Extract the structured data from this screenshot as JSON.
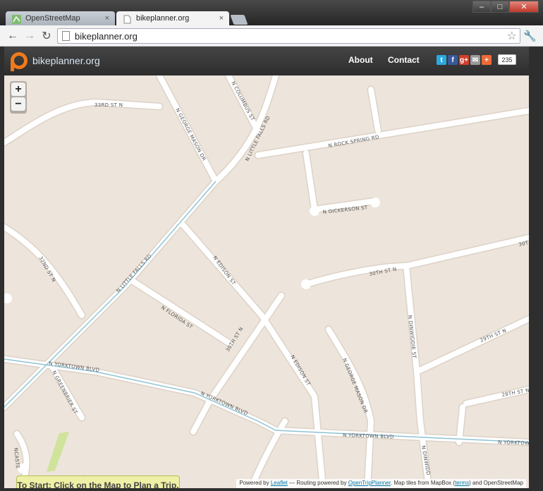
{
  "browser": {
    "tabs": [
      {
        "title": "OpenStreetMap",
        "close": "×"
      },
      {
        "title": "bikeplanner.org",
        "close": "×"
      }
    ],
    "url": "bikeplanner.org",
    "window_buttons": [
      "–",
      "□",
      "✕"
    ]
  },
  "site": {
    "brand": "bikeplanner.org",
    "nav": {
      "about": "About",
      "contact": "Contact"
    },
    "share_count": "235",
    "accent": "#f07a1a"
  },
  "map": {
    "zoom_in": "+",
    "zoom_out": "−",
    "hint": "To Start: Click on the Map to Plan a Trip.",
    "labels": {
      "st33": "33RD ST N",
      "george_mason_n": "N GEORGE MASON DR",
      "columbus": "N COLUMBUS ST",
      "little_falls_n": "N LITTLE FALLS RD",
      "rock_spring": "N ROCK SPRING RD",
      "dickerson": "N DICKERSON ST",
      "st32": "32ND ST N",
      "little_falls_s": "N LITTLE FALLS RD",
      "edison_n": "N EDISON ST",
      "st30": "30TH ST N",
      "st30_right": "30T",
      "florida": "N FLORIDA ST",
      "st30_mid": "30TH ST N",
      "dinwiddie": "N DINWIDDIE ST",
      "st29": "29TH ST N",
      "yorktown_w": "N YORKTOWN BLVD",
      "greenbrier": "N GREENBRIER ST",
      "yorktown_mid": "N YORKTOWN BLVD",
      "edison_s": "N EDISON ST",
      "george_mason_s": "N GEORGE MASON DR",
      "st28": "28TH ST N",
      "yorktown_e": "N YORKTOWN BLVD",
      "yorktown_far": "N YORKTOW",
      "dinwiddie_s": "N DINWIDD",
      "lancaster": "NCASTE"
    },
    "attribution": {
      "prefix": "Powered by",
      "leaflet": "Leaflet",
      "routing": "— Routing powered by",
      "otp": "OpenTripPlanner",
      "tiles": ". Map tiles from MapBox (",
      "terms": "terms",
      "suffix": ") and OpenStreetMap"
    }
  }
}
